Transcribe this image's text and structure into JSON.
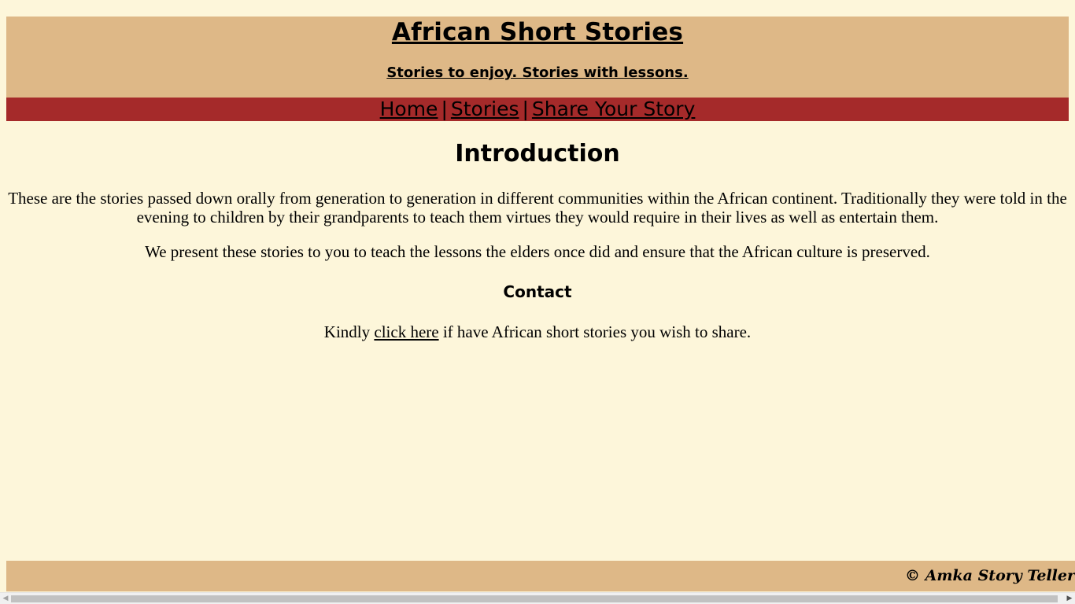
{
  "header": {
    "title": "African Short Stories",
    "tagline": "Stories to enjoy. Stories with lessons."
  },
  "nav": {
    "items": [
      {
        "label": "Home"
      },
      {
        "label": "Stories"
      },
      {
        "label": "Share Your Story"
      }
    ],
    "separator": "|"
  },
  "main": {
    "intro_heading": "Introduction",
    "paragraph_1": "These are the stories passed down orally from generation to generation in different communities within the African continent. Traditionally they were told in the evening to children by their grandparents to teach them virtues they would require in their lives as well as entertain them.",
    "paragraph_2": "We present these stories to you to teach the lessons the elders once did and ensure that the African culture is preserved.",
    "contact_heading": "Contact",
    "contact_prefix": "Kindly ",
    "contact_link": "click here",
    "contact_suffix": " if have African short stories you wish to share."
  },
  "footer": {
    "copyright": "© Amka Story Teller"
  },
  "scrollbar": {
    "left_arrow_icon": "triangle-left",
    "right_arrow_icon": "triangle-right"
  },
  "colors": {
    "page_background": "#fdf6da",
    "header_background": "#deb887",
    "nav_background": "#a52a2a",
    "footer_background": "#deb887"
  }
}
